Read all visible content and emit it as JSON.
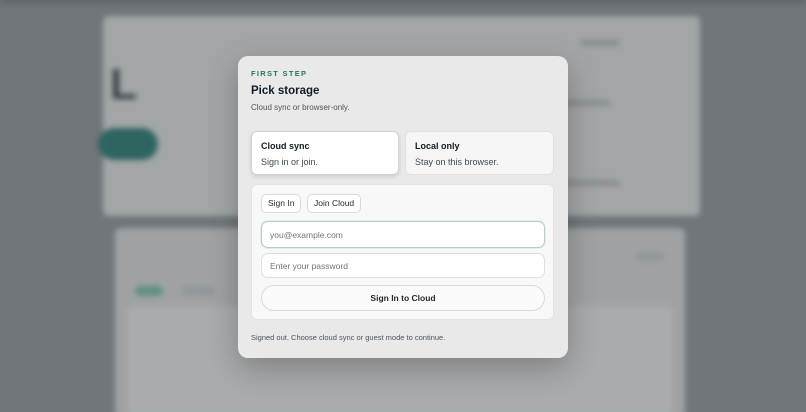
{
  "modal": {
    "eyebrow": "FIRST STEP",
    "title": "Pick storage",
    "subtitle": "Cloud sync or browser-only.",
    "options": [
      {
        "title": "Cloud sync",
        "description": "Sign in or join.",
        "selected": true
      },
      {
        "title": "Local only",
        "description": "Stay on this browser.",
        "selected": false
      }
    ],
    "auth": {
      "tabs": [
        "Sign In",
        "Join Cloud"
      ],
      "email_placeholder": "you@example.com",
      "email_value": "",
      "password_placeholder": "Enter your password",
      "password_value": "",
      "submit_label": "Sign In to Cloud"
    },
    "status": "Signed out. Choose cloud sync or guest mode to continue."
  },
  "colors": {
    "accent": "#2a7466",
    "background_dim": "#7d8388",
    "modal_bg": "#e9e9ea"
  }
}
